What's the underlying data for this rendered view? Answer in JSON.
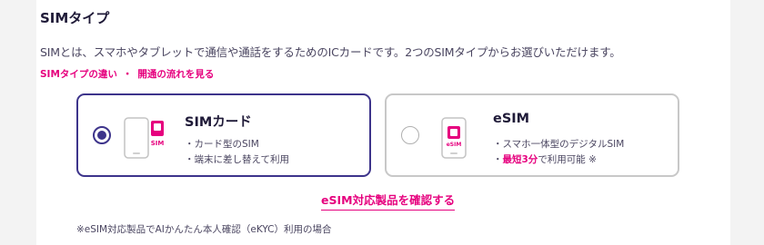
{
  "section": {
    "title": "SIMタイプ",
    "description": "SIMとは、スマホやタブレットで通信や通話をするためのICカードです。2つのSIMタイプからお選びいただけます。",
    "link_difference": "SIMタイプの違い",
    "link_separator": "・",
    "link_flow": "開通の流れを見る"
  },
  "options": [
    {
      "name": "SIMカード",
      "chip_label": "SIM",
      "selected": true,
      "features": [
        "・カード型のSIM",
        "・端末に差し替えて利用"
      ]
    },
    {
      "name": "eSIM",
      "chip_label": "eSIM",
      "selected": false,
      "features": [
        "・スマホ一体型のデジタルSIM"
      ],
      "feature_highlight_prefix": "・",
      "feature_highlight": "最短3分",
      "feature_highlight_suffix": "で利用可能 ※"
    }
  ],
  "confirm_link": "eSIM対応製品を確認する",
  "footnote": "※eSIM対応製品でAIかんたん本人確認（eKYC）利用の場合",
  "colors": {
    "brand_pink": "#e6007e",
    "selected_border": "#3d348b",
    "unselected_border": "#c8c8c8"
  }
}
